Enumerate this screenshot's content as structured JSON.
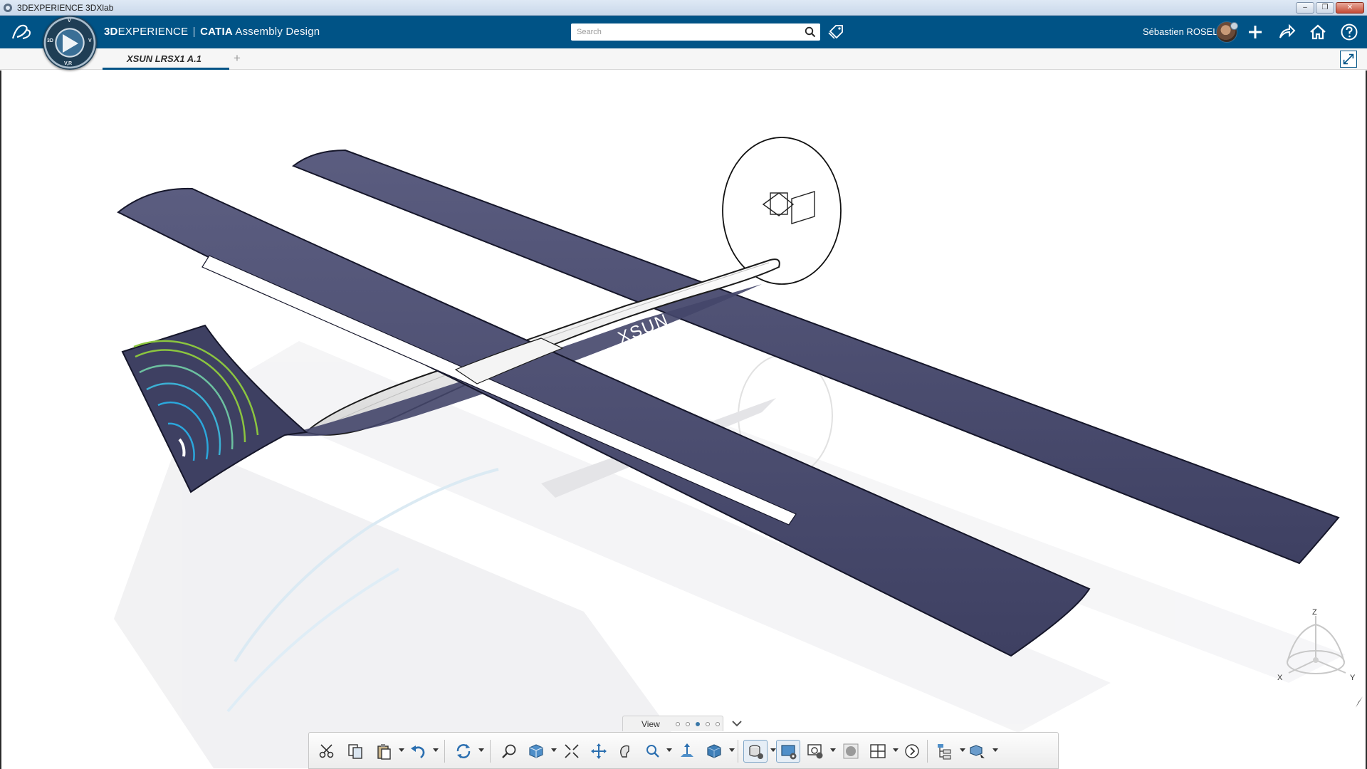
{
  "window": {
    "title": "3DEXPERIENCE 3DXlab",
    "minimize_label": "–",
    "restore_label": "❐",
    "close_label": "✕"
  },
  "header": {
    "brand_3d": "3D",
    "brand_experience": "EXPERIENCE",
    "brand_sep": "|",
    "brand_app": "CATIA",
    "brand_role": "Assembly Design",
    "search_placeholder": "Search",
    "user_name": "Sébastien ROSEL",
    "icons": [
      "search-icon",
      "tag-icon",
      "plus-icon",
      "share-icon",
      "home-icon",
      "help-icon"
    ]
  },
  "compass": {
    "north": "V",
    "west": "3D",
    "east": "V",
    "south": "V,R"
  },
  "tabs": {
    "active": "XSUN LRSX1 A.1",
    "add": "+"
  },
  "model": {
    "logo_text": "XSUN",
    "colors": {
      "wing": "#4a4c6e",
      "wing_edge": "#1b1c2e",
      "fuselage": "#f2f2f2",
      "tail_rings_inner": "#2ba7dc",
      "tail_rings_outer": "#8bc53f"
    }
  },
  "view_bar": {
    "label": "View",
    "pages": 5,
    "active_page": 3
  },
  "actionbar": {
    "tools": [
      "cut-icon",
      "copy-icon",
      "paste-icon",
      "undo-icon",
      "update-icon",
      "fit-all-icon",
      "view-cube-icon",
      "zoom-area-icon",
      "pan-icon",
      "rotate-icon",
      "zoom-icon",
      "normal-view-icon",
      "shading-icon",
      "render-style-icon",
      "display-settings-icon",
      "capture-icon",
      "ambiance-icon",
      "layout-icon",
      "next-icon",
      "tree-icon",
      "explode-icon"
    ]
  },
  "triad": {
    "x": "X",
    "y": "Y",
    "z": "Z"
  }
}
